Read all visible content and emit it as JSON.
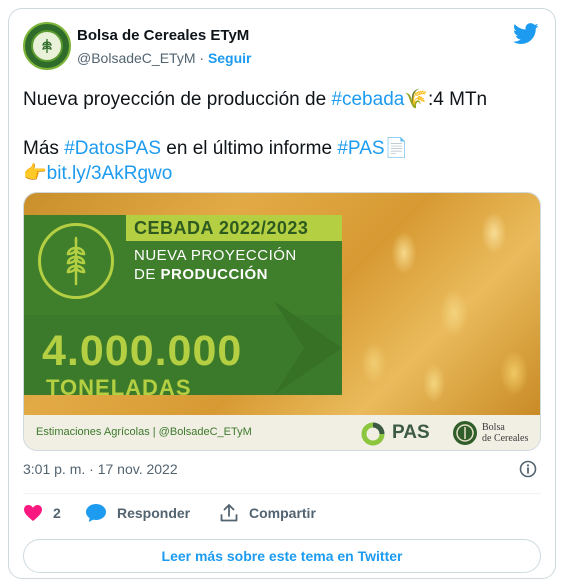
{
  "user": {
    "display_name": "Bolsa de Cereales ETyM",
    "handle": "@BolsadeC_ETyM",
    "separator": "·",
    "follow_label": "Seguir"
  },
  "tweet": {
    "line1_prefix": "Nueva proyección de producción de ",
    "line1_tag": "#cebada",
    "line1_emoji": "🌾",
    "line1_suffix": ":4 MTn",
    "line2_prefix": "Más ",
    "line2_tag1": "#DatosPAS",
    "line2_middle": " en el último informe ",
    "line2_tag2": "#PAS",
    "line2_emoji": "📄",
    "line3_emoji": "👉",
    "line3_link": "bit.ly/3AkRgwo"
  },
  "media": {
    "title": "CEBADA 2022/2023",
    "subtitle_line1": "NUEVA PROYECCIÓN",
    "subtitle_line2_prefix": "DE ",
    "subtitle_line2_bold": "PRODUCCIÓN",
    "value": "4.000.000",
    "unit": "TONELADAS",
    "footer_text": "Estimaciones Agrícolas | @BolsadeC_ETyM",
    "pas_label": "PAS",
    "bolsa_line1": "Bolsa",
    "bolsa_line2": "de Cereales",
    "colors": {
      "panel_green": "#3f7f2c",
      "accent_lime": "#b5cf42"
    }
  },
  "meta": {
    "timestamp": "3:01 p. m. · 17 nov. 2022"
  },
  "actions": {
    "likes_count": "2",
    "reply_label": "Responder",
    "share_label": "Compartir"
  },
  "readmore_label": "Leer más sobre este tema en Twitter",
  "icons": {
    "brand": "twitter-bird-icon",
    "like": "heart-icon",
    "reply": "speech-bubble-icon",
    "share": "share-upload-icon",
    "info": "info-icon"
  },
  "colors": {
    "link_blue": "#1d9bf0",
    "like_pink": "#f91880",
    "muted": "#536471"
  }
}
